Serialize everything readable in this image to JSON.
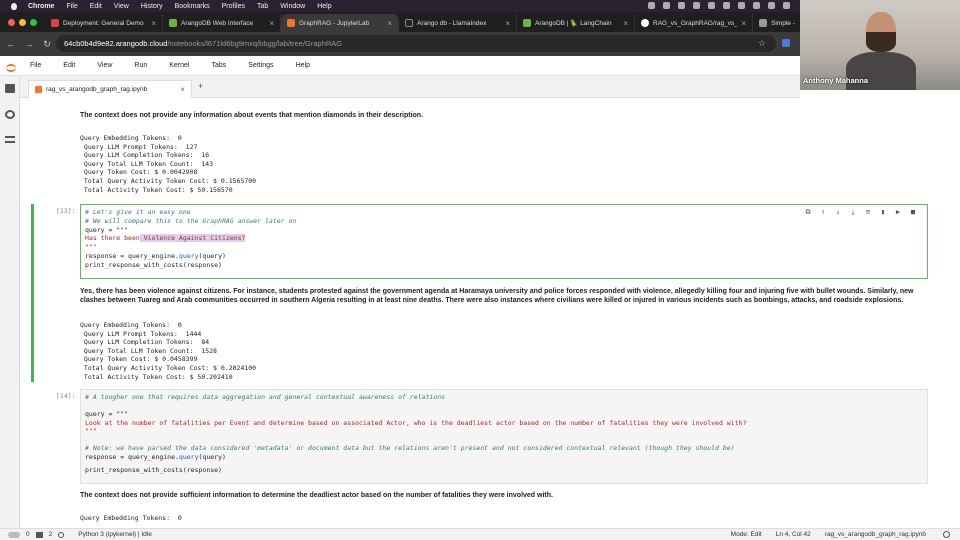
{
  "mac_menu": {
    "app": "Chrome",
    "items": [
      "File",
      "Edit",
      "View",
      "History",
      "Bookmarks",
      "Profiles",
      "Tab",
      "Window",
      "Help"
    ]
  },
  "browser_tabs": [
    {
      "title": "Deployment: General Demo",
      "color": "#e04040",
      "active": false
    },
    {
      "title": "ArangoDB Web Interface",
      "color": "#6cb33f",
      "active": false
    },
    {
      "title": "GraphRAG - JupyterLab",
      "color": "#f37726",
      "active": true
    },
    {
      "title": "Arango db - LlamaIndex",
      "color": "#222222",
      "active": false
    },
    {
      "title": "ArangoDB | 🦜 LangChain",
      "color": "#6cb33f",
      "active": false
    },
    {
      "title": "RAG_vs_GraphRAG/rag_vs_...",
      "color": "#ffffff",
      "active": false
    },
    {
      "title": "Simple -",
      "color": "#999999",
      "active": false
    }
  ],
  "address": {
    "host": "64cb0b4d9e82.arangodb.cloud",
    "path": "/notebooks/l671ld6bg9mxq/bbgg/lab/tree/GraphRAG"
  },
  "jupyter_menu": [
    "File",
    "Edit",
    "View",
    "Run",
    "Kernel",
    "Tabs",
    "Settings",
    "Help"
  ],
  "webcam": {
    "name": "Anthony Mahanna"
  },
  "doc_tab": {
    "title": "rag_vs_arangodb_graph_rag.ipynb"
  },
  "output1": {
    "answer": "The context does not provide any information about events that mention diamonds in their description.",
    "stats": "Query Embedding Tokens:  0\n Query LLM Prompt Tokens:  127\n Query LLM Completion Tokens:  16\n Query Total LLM Token Count:  143\n Query Token Cost: $ 0.0042908\n Total Query Activity Token Cost: $ 0.1565700\n Total Activity Token Cost: $ 50.156570"
  },
  "cell13": {
    "prompt": "[13]:",
    "line1": "# Let's give it an easy one",
    "line2": "# We will compare this to the GraphRAG answer later on",
    "line3": "query = \"\"\"",
    "line4a": "Has there been",
    "line4b": " Violence Against Citizens?",
    "line5": "\"\"\"",
    "line6a": "response = query_engine.",
    "line6b": "query",
    "line6c": "(query)",
    "line7": "print_response_with_costs(response)"
  },
  "output2": {
    "answer": "Yes, there has been violence against citizens. For instance, students protested against the government agenda at Haramaya university and police forces responded with violence, allegedly killing four and injuring five with bullet wounds. Similarly, new clashes between Tuareg and Arab communities occurred in southern Algeria resulting in at least nine deaths. There were also instances where civilians were killed or injured in various incidents such as bombings, attacks, and roadside explosions.",
    "stats": "Query Embedding Tokens:  0\n Query LLM Prompt Tokens:  1444\n Query LLM Completion Tokens:  84\n Query Total LLM Token Count:  1528\n Query Token Cost: $ 0.0458399\n Total Query Activity Token Cost: $ 0.2024100\n Total Activity Token Cost: $ 50.202410"
  },
  "cell14": {
    "prompt": "[14]:",
    "line1": "# A tougher one that requires data aggregation and general contextual awareness of relations",
    "line2": "query = \"\"\"",
    "line3": "Look at the number of fatalities per Event and determine based on associated Actor, who is the deadliest actor based on the number of fatalities they were involved with?",
    "line4": "\"\"\"",
    "line5": "# Note: we have parsed the data considered 'metadata' or document data but the relations aren't present and not considered contextual relevant (though they should be)",
    "line6a": "response = query_engine.",
    "line6b": "query",
    "line6c": "(query)",
    "line7": "print_response_with_costs(response)"
  },
  "output3": {
    "answer": "The context does not provide sufficient information to determine the deadliest actor based on the number of fatalities they were involved with.",
    "stats": "Query Embedding Tokens:  0"
  },
  "status": {
    "left_count_a": "0",
    "left_count_b": "2",
    "kernel": "Python 3 (ipykernel) | Idle",
    "mode": "Mode: Edit",
    "position": "Ln 4, Col 42",
    "file": "rag_vs_arangodb_graph_rag.ipynb"
  }
}
